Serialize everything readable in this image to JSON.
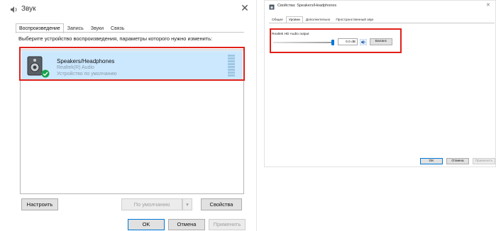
{
  "sound_window": {
    "title": "Звук",
    "tabs": [
      {
        "label": "Воспроизведение",
        "active": true
      },
      {
        "label": "Запись",
        "active": false
      },
      {
        "label": "Звуки",
        "active": false
      },
      {
        "label": "Связь",
        "active": false
      }
    ],
    "instruction": "Выберите устройство воспроизведения, параметры которого нужно изменить:",
    "device": {
      "name": "Speakers/Headphones",
      "driver": "Realtek(R) Audio",
      "status": "Устройство по умолчанию",
      "icon": "speaker-icon",
      "badge": "default-check-icon"
    },
    "buttons": {
      "setup": "Настроить",
      "set_default": "По умолчанию",
      "properties": "Свойства",
      "ok": "OK",
      "cancel": "Отмена",
      "apply": "Применить"
    }
  },
  "props_window": {
    "title": "Свойства: Speakers/Headphones",
    "tabs": [
      {
        "label": "Общие",
        "active": false
      },
      {
        "label": "Уровни",
        "active": true
      },
      {
        "label": "Дополнительно",
        "active": false
      },
      {
        "label": "Пространственный звук",
        "active": false
      }
    ],
    "level": {
      "label": "Realtek HD Audio output",
      "value": "0.0 dB",
      "slider_fraction": 1.0,
      "balance_label": "Баланс"
    },
    "buttons": {
      "ok": "OK",
      "cancel": "Отмена",
      "apply": "Применить"
    }
  },
  "colors": {
    "highlight": "#e0201a",
    "selection": "#cce8ff",
    "accent": "#0078d7"
  }
}
